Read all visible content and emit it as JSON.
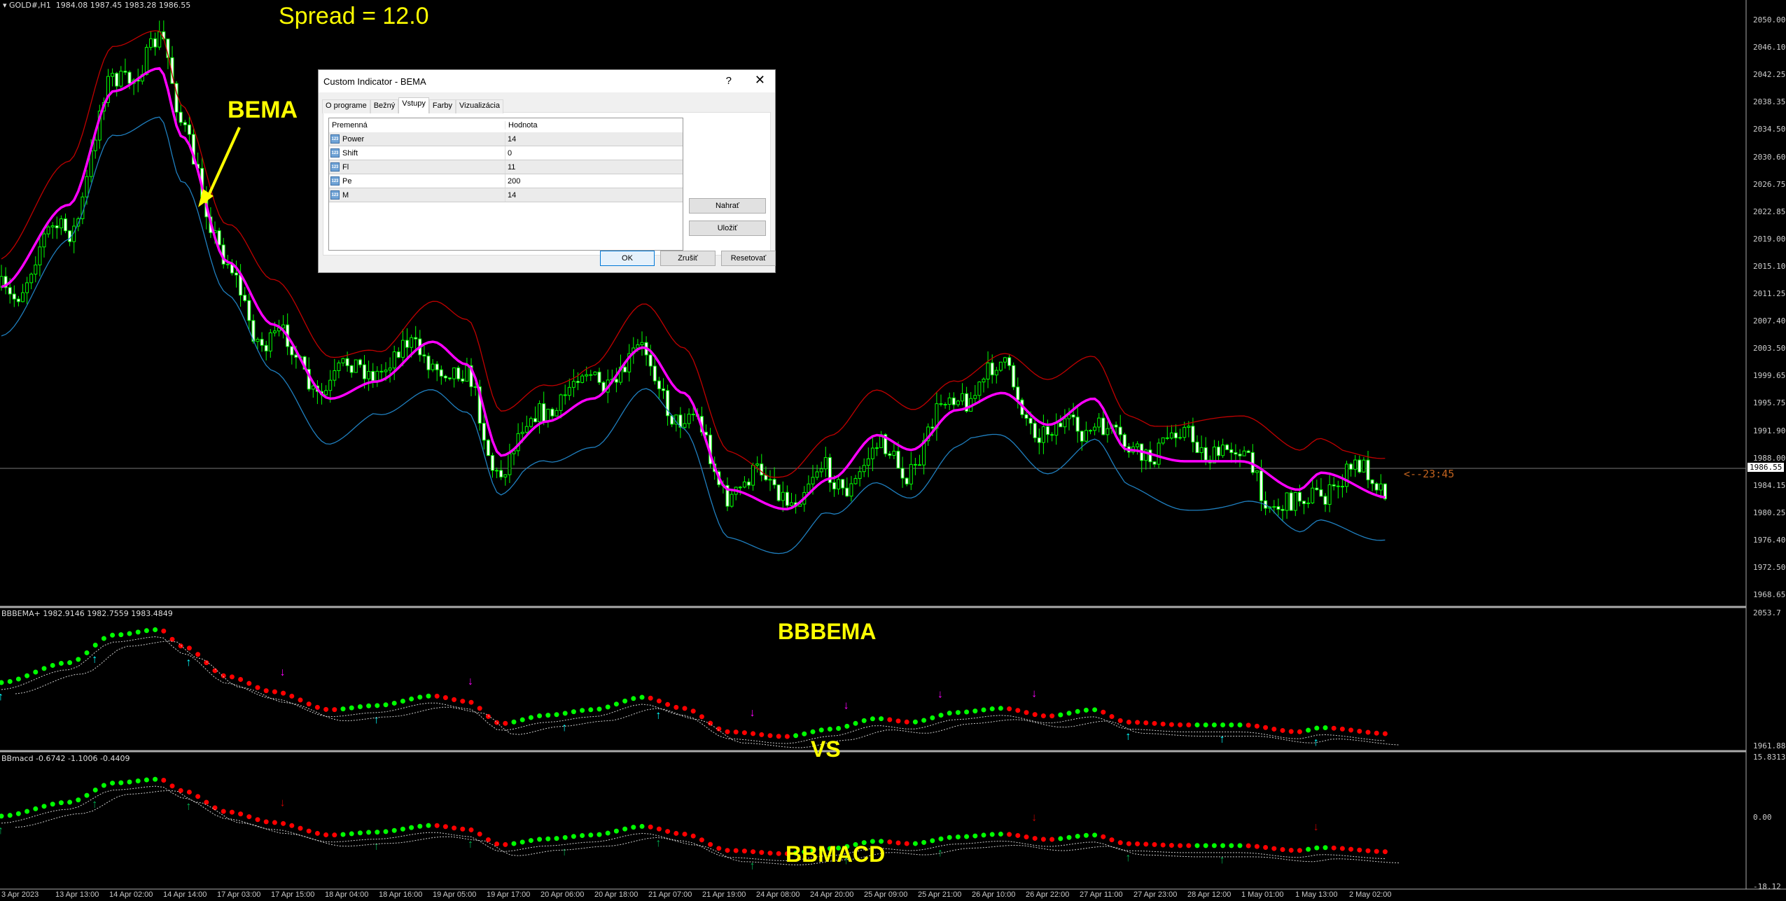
{
  "header": {
    "symbol": "GOLD#,H1",
    "ohlc": "1984.08 1987.45 1983.28 1986.55"
  },
  "spread": "Spread = 12.0",
  "annotations": {
    "bema": "BEMA",
    "bbbema": "BBBEMA",
    "vs": "VS",
    "bbmacd": "BBMACD"
  },
  "countdown": "<--23:45",
  "price_axis": {
    "labels": [
      "2050.00",
      "2046.10",
      "2042.25",
      "2038.35",
      "2034.50",
      "2030.60",
      "2026.75",
      "2022.85",
      "2019.00",
      "2015.10",
      "2011.25",
      "2007.40",
      "2003.50",
      "1999.65",
      "1995.75",
      "1991.90",
      "1988.00",
      "1984.15",
      "1980.25",
      "1976.40",
      "1972.50",
      "1968.65"
    ],
    "current": "1986.55"
  },
  "subpanel1": {
    "label": "BBBEMA+ 1982.9146 1982.7559 1983.4849",
    "max": "2053.7",
    "min": "1961.8841"
  },
  "subpanel2": {
    "label": "BBmacd -0.6742 -1.1006 -0.4409",
    "max": "15.8313",
    "zero": "0.00",
    "min": "-18.12"
  },
  "time_axis": [
    "3 Apr 2023",
    "13 Apr 13:00",
    "14 Apr 02:00",
    "14 Apr 14:00",
    "17 Apr 03:00",
    "17 Apr 15:00",
    "18 Apr 04:00",
    "18 Apr 16:00",
    "19 Apr 05:00",
    "19 Apr 17:00",
    "20 Apr 06:00",
    "20 Apr 18:00",
    "21 Apr 07:00",
    "21 Apr 19:00",
    "24 Apr 08:00",
    "24 Apr 20:00",
    "25 Apr 09:00",
    "25 Apr 21:00",
    "26 Apr 10:00",
    "26 Apr 22:00",
    "27 Apr 11:00",
    "27 Apr 23:00",
    "28 Apr 12:00",
    "1 May 01:00",
    "1 May 13:00",
    "2 May 02:00"
  ],
  "colors": {
    "bull": "#00ff00",
    "bear": "#ffffff",
    "bema": "#ff00ff",
    "upper_band": "#c00000",
    "lower_band": "#1f7fbf",
    "dot_up": "#00ff00",
    "dot_down": "#ff0000",
    "arrow_up": "#00ffff",
    "arrow_down": "#ff00ff",
    "annotation": "#ffff00"
  },
  "dialog": {
    "title": "Custom Indicator - BEMA",
    "help": "?",
    "close": "✕",
    "tabs": [
      "O programe",
      "Bežný",
      "Vstupy",
      "Farby",
      "Vizualizácia"
    ],
    "active_tab": "Vstupy",
    "columns": [
      "Premenná",
      "Hodnota"
    ],
    "inputs": [
      {
        "name": "Power",
        "value": "14"
      },
      {
        "name": "Shift",
        "value": "0"
      },
      {
        "name": "Fl",
        "value": "11"
      },
      {
        "name": "Pe",
        "value": "200"
      },
      {
        "name": "M",
        "value": "14"
      }
    ],
    "buttons": {
      "load": "Nahrať",
      "save": "Uložiť",
      "ok": "OK",
      "cancel": "Zrušiť",
      "reset": "Resetovať"
    }
  }
}
